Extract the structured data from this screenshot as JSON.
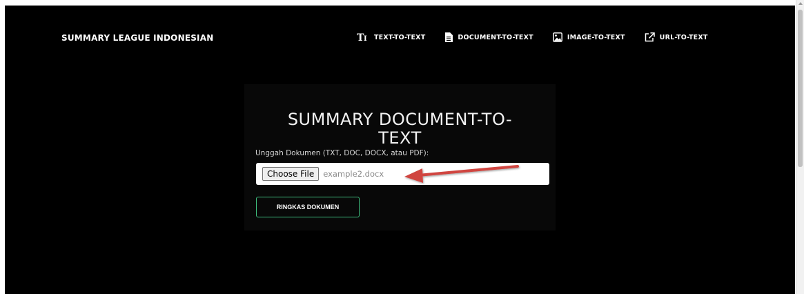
{
  "app": {
    "brand": "SUMMARY LEAGUE INDONESIAN"
  },
  "nav": {
    "items": [
      {
        "label": "TEXT-TO-TEXT",
        "icon": "text-type-icon"
      },
      {
        "label": "DOCUMENT-TO-TEXT",
        "icon": "document-icon"
      },
      {
        "label": "IMAGE-TO-TEXT",
        "icon": "image-icon"
      },
      {
        "label": "URL-TO-TEXT",
        "icon": "external-link-icon"
      }
    ]
  },
  "main": {
    "title_line1": "SUMMARY DOCUMENT-TO-",
    "title_line2": "TEXT",
    "upload_label": "Unggah Dokumen (TXT, DOC, DOCX, atau PDF):",
    "choose_file_label": "Choose File",
    "selected_file": "example2.docx",
    "submit_label": "RINGKAS DOKUMEN"
  },
  "colors": {
    "background": "#000000",
    "card": "#080808",
    "accent_border": "#3fbf7f",
    "annotation_arrow": "#d0453f"
  }
}
